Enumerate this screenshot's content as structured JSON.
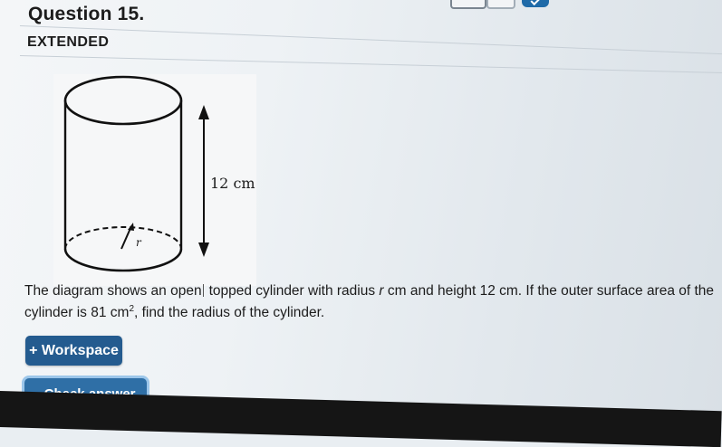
{
  "header": {
    "question_title": "Question 15.",
    "tag": "EXTENDED"
  },
  "diagram": {
    "height_label": "12 cm",
    "radius_label": "r"
  },
  "question": {
    "line1_a": "The diagram shows an open",
    "line1_b": "topped cylinder with radius ",
    "line1_r": "r",
    "line1_c": " cm and height 12 cm. If the outer surface area of the",
    "line2_a": "cylinder is 81 cm",
    "line2_sup": "2",
    "line2_b": ", find the radius of the cylinder."
  },
  "buttons": {
    "workspace": "+ Workspace",
    "check_answer": "- Check answer"
  },
  "colors": {
    "primary_button": "#245b8f",
    "focus_ring": "#9cc6ea"
  }
}
